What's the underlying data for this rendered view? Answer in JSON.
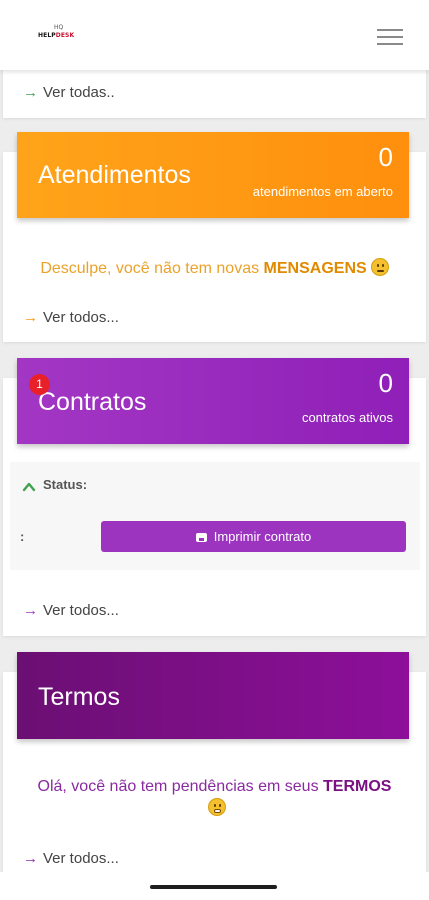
{
  "header": {
    "logo_top": "HQ",
    "logo_help": "HELP",
    "logo_desk": "DESK",
    "menu_icon": "hamburger-icon"
  },
  "top_card": {
    "link_label": "Ver todas.."
  },
  "atendimentos": {
    "title": "Atendimentos",
    "count": "0",
    "subtitle": "atendimentos em aberto",
    "message_prefix": "Desculpe, você não tem novas ",
    "message_bold": "MENSAGENS",
    "message_emoji": "confused-face-icon",
    "link_label": "Ver todos...",
    "color": "#ffa41a",
    "message_color": "#eba22a"
  },
  "contratos": {
    "title": "Contratos",
    "badge": "1",
    "count": "0",
    "subtitle": "contratos ativos",
    "status_label": "Status:",
    "status_value": ":",
    "print_button": "Imprimir contrato",
    "link_label": "Ver todos...",
    "color": "#9c34c0"
  },
  "termos": {
    "title": "Termos",
    "message_prefix": "Olá, você não tem pendências em seus ",
    "message_bold": "TERMOS",
    "message_emoji": "grinning-face-icon",
    "link_label": "Ver todos...",
    "color": "#7a1084",
    "message_color": "#8a2aa0"
  }
}
